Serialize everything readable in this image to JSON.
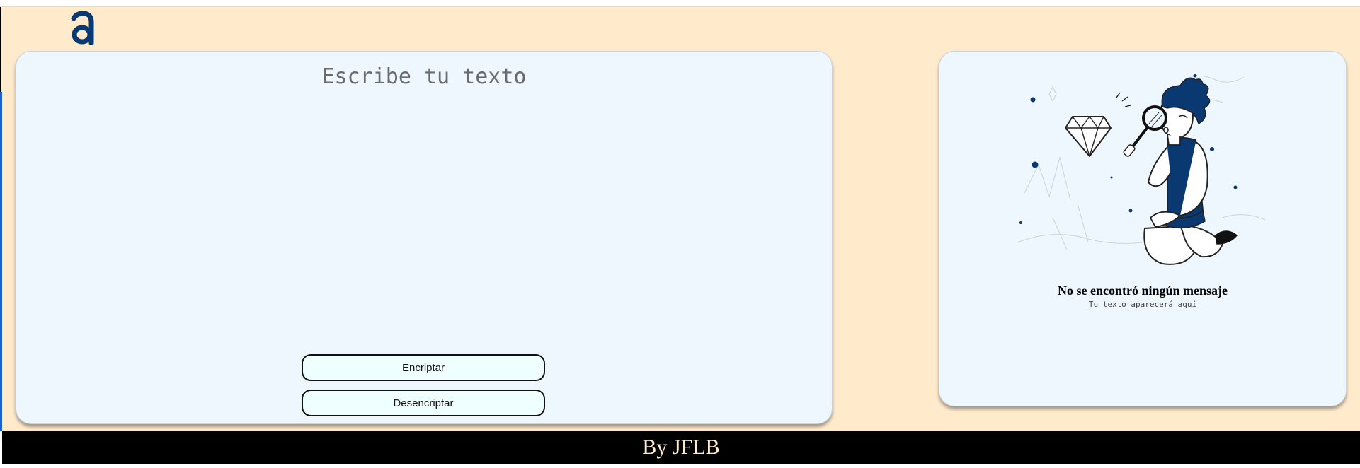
{
  "logo": {
    "name": "alura-logo",
    "color": "#0a3871"
  },
  "input": {
    "placeholder": "Escribe tu texto",
    "value": ""
  },
  "buttons": {
    "encrypt_label": "Encriptar",
    "decrypt_label": "Desencriptar"
  },
  "output": {
    "title": "No se encontró ningún mensaje",
    "subtitle": "Tu texto aparecerá aquí",
    "illustration": "person-with-magnifier-and-diamond"
  },
  "footer": {
    "text": "By JFLB"
  },
  "colors": {
    "background": "#ffeacc",
    "card": "#eef6fe",
    "button": "#effffd",
    "accent": "#0a3871",
    "footer": "#000000"
  }
}
